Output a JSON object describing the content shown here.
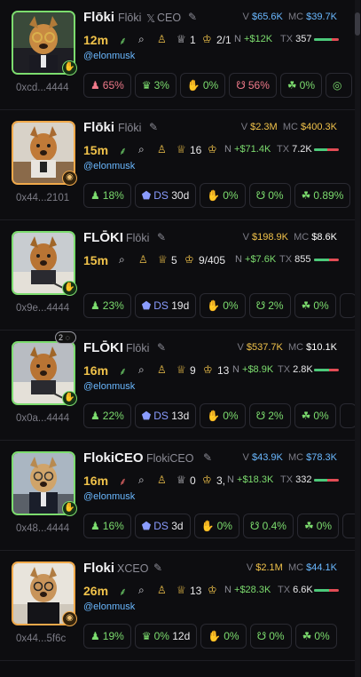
{
  "cards": [
    {
      "name": "Flōki",
      "subtitle": "Flōki",
      "x_label": "CEO",
      "volume_label": "V",
      "volume": "$65.6K",
      "mc_label": "MC",
      "mc": "$39.7K",
      "age": "12m",
      "holders": "1",
      "crown": "2/1",
      "net": "+$12K",
      "tx_label": "TX",
      "tx": "357",
      "handle": "@elonmusk",
      "address": "0xcd...4444",
      "chips": {
        "top10": "65%",
        "dev": "3%",
        "insiders": "0%",
        "bundle": "56%",
        "snipers": "0%"
      }
    },
    {
      "name": "Flōki",
      "subtitle": "Flōki",
      "volume_label": "V",
      "volume": "$2.3M",
      "mc_label": "MC",
      "mc": "$400.3K",
      "age": "15m",
      "holders": "16",
      "net_label": "N",
      "net": "+$71.4K",
      "tx_label": "TX",
      "tx": "7.2K",
      "handle": "@elonmusk",
      "address": "0x44...2101",
      "chips": {
        "top10": "18%",
        "ds": "DS",
        "ds_age": "30d",
        "insiders": "0%",
        "bundle": "0%",
        "snipers": "0.89%"
      }
    },
    {
      "name": "FLŌKI",
      "subtitle": "Flōki",
      "volume_label": "V",
      "volume": "$198.9K",
      "mc_label": "MC",
      "mc": "$8.6K",
      "age": "15m",
      "holders": "5",
      "crown": "9/405",
      "net_label": "N",
      "net": "+$7.6K",
      "tx_label": "TX",
      "tx": "855",
      "address": "0x9e...4444",
      "chips": {
        "top10": "23%",
        "ds": "DS",
        "ds_age": "19d",
        "insiders": "0%",
        "bundle": "2%",
        "snipers": "0%"
      }
    },
    {
      "name": "FLŌKI",
      "subtitle": "Flōki",
      "corner_badge": "2",
      "volume_label": "V",
      "volume": "$537.7K",
      "mc_label": "MC",
      "mc": "$10.1K",
      "age": "16m",
      "holders": "9",
      "crown": "13",
      "net_label": "N",
      "net": "+$8.9K",
      "tx_label": "TX",
      "tx": "2.8K",
      "handle": "@elonmusk",
      "address": "0x0a...4444",
      "chips": {
        "top10": "22%",
        "ds": "DS",
        "ds_age": "13d",
        "insiders": "0%",
        "bundle": "2%",
        "snipers": "0%"
      }
    },
    {
      "name": "FlokiCEO",
      "subtitle": "FlokiCEO",
      "volume_label": "V",
      "volume": "$43.9K",
      "mc_label": "MC",
      "mc": "$78.3K",
      "age": "16m",
      "holders": "0",
      "crown": "3,",
      "net_label": "N",
      "net": "+$18.3K",
      "tx_label": "TX",
      "tx": "332",
      "handle": "@elonmusk",
      "address": "0x48...4444",
      "chips": {
        "top10": "16%",
        "ds": "DS",
        "ds_age": "3d",
        "insiders": "0%",
        "bundle": "0.4%",
        "snipers": "0%"
      }
    },
    {
      "name": "Floki",
      "subtitle": "XCEO",
      "volume_label": "V",
      "volume": "$2.1M",
      "mc_label": "MC",
      "mc": "$44.1K",
      "age": "26m",
      "holders": "13",
      "net_label": "N",
      "net": "+$28.3K",
      "tx_label": "TX",
      "tx": "6.6K",
      "handle": "@elonmusk",
      "address": "0x44...5f6c",
      "chips": {
        "top10": "19%",
        "dev": "0%",
        "dev_age": "12d",
        "insiders": "0%",
        "bundle": "0%",
        "snipers": "0%"
      }
    }
  ],
  "tx_buy_ratio": [
    0.7,
    0.55,
    0.6,
    0.6,
    0.55,
    0.6
  ],
  "icons": {
    "sprout": "leaf-icon",
    "search": "search-icon",
    "holders": "user-icon",
    "trophy": "trophy-icon",
    "crown": "crown-icon"
  },
  "colors": {
    "positive": "#7cdc6e",
    "negative": "#f07a8a",
    "volume": "#6ab8ff",
    "highlight": "#f0c24a"
  }
}
